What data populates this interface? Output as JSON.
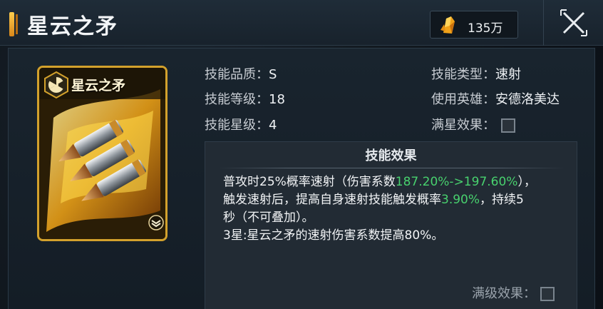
{
  "header": {
    "title": "星云之矛",
    "currency": {
      "icon": "gold-crystal-icon",
      "value": "135万"
    },
    "close_icon": "close-icon"
  },
  "card": {
    "name": "星云之矛",
    "badge_icon": "radiation-badge-icon",
    "level_icon": "rank-chevron-icon",
    "art": "bullets-flame-art"
  },
  "info_left": [
    {
      "label": "技能品质：",
      "value": "S"
    },
    {
      "label": "技能等级：",
      "value": "18"
    },
    {
      "label": "技能星级：",
      "value": "4"
    }
  ],
  "info_right": [
    {
      "label": "技能类型：",
      "value": "速射"
    },
    {
      "label": "使用英雄：",
      "value": "安德洛美达"
    },
    {
      "label": "满星效果：",
      "value": ""
    }
  ],
  "effect": {
    "title": "技能效果",
    "line1_prefix": "普攻时25%概率速射（伤害系数",
    "line1_highlight": "187.20%->197.60%",
    "line1_suffix": "），",
    "line2_prefix": "触发速射后，提高自身速射技能触发概率",
    "line2_highlight": "3.90%",
    "line2_suffix": "，持续5",
    "line3": "秒（不可叠加）。",
    "line4": "3星:星云之矛的速射伤害系数提高80%。",
    "max_level_label": "满级效果："
  },
  "colors": {
    "highlight": "#48d16e",
    "card_border": "#d3a12c",
    "accent": "#ffce4d"
  }
}
